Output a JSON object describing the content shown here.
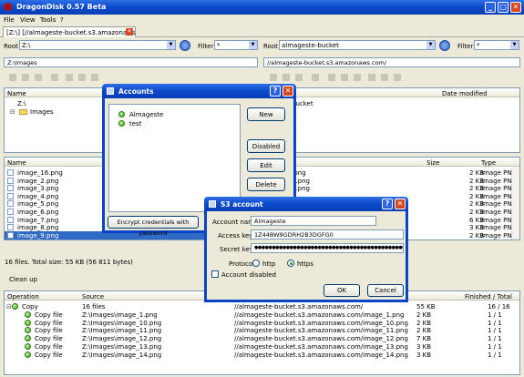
{
  "window": {
    "title": "DragonDisk 0.57 Beta"
  },
  "menu": [
    "File",
    "View",
    "Tools",
    "?"
  ],
  "tab": {
    "label": "[Z:\\] [//almageste-bucket.s3.amazonaws.com/]"
  },
  "left": {
    "root_label": "Root",
    "root_value": "Z:\\",
    "filter_label": "Filter",
    "filter_value": "*",
    "path": "Z:\\Images",
    "tree_header": "Name",
    "tree_items": [
      "Z:\\",
      "Images"
    ],
    "list_headers": [
      "Name"
    ],
    "files": [
      "image_16.png",
      "image_2.png",
      "image_3.png",
      "image_4.png",
      "image_5.png",
      "image_6.png",
      "image_7.png",
      "image_8.png",
      "image_9.png"
    ],
    "status": "16 files. Total size: 55 KB (56 811 bytes)"
  },
  "right": {
    "root_label": "Root",
    "root_value": "almageste-bucket",
    "filter_label": "Filter",
    "filter_value": "*",
    "path": "//almageste-bucket.s3.amazonaws.com/",
    "tree_headers": [
      "",
      "Date modified"
    ],
    "tree_value": "bucket",
    "list_headers": [
      "",
      "Size",
      "Type"
    ],
    "files": [
      {
        "name": ".png",
        "size": "2 KB",
        "type": "Image PNG"
      },
      {
        "name": "0.png",
        "size": "2 KB",
        "type": "Image PNG"
      },
      {
        "name": "1.png",
        "size": "2 KB",
        "type": "Image PNG"
      },
      {
        "name": "",
        "size": "2 KB",
        "type": "Image PNG"
      },
      {
        "name": "",
        "size": "2 KB",
        "type": "Image PNG"
      },
      {
        "name": "",
        "size": "2 KB",
        "type": "Image PNG"
      },
      {
        "name": "",
        "size": "6 KB",
        "type": "Image PNG"
      },
      {
        "name": "",
        "size": "3 KB",
        "type": "Image PNG"
      },
      {
        "name": "",
        "size": "2 KB",
        "type": "Image PNG"
      }
    ]
  },
  "cleanup": "Clean up",
  "queue": {
    "headers": [
      "Operation",
      "Source",
      "",
      "Finished / Total"
    ],
    "rows": [
      {
        "op": "Copy",
        "src": "16 files",
        "dst": "//almageste-bucket.s3.amazonaws.com/",
        "size": "55 KB",
        "fin": "16 / 16"
      },
      {
        "op": "Copy file",
        "src": "Z:\\Images\\image_1.png",
        "dst": "//almageste-bucket.s3.amazonaws.com/image_1.png",
        "size": "2 KB",
        "fin": "1 / 1"
      },
      {
        "op": "Copy file",
        "src": "Z:\\Images\\image_10.png",
        "dst": "//almageste-bucket.s3.amazonaws.com/image_10.png",
        "size": "2 KB",
        "fin": "1 / 1"
      },
      {
        "op": "Copy file",
        "src": "Z:\\Images\\image_11.png",
        "dst": "//almageste-bucket.s3.amazonaws.com/image_11.png",
        "size": "2 KB",
        "fin": "1 / 1"
      },
      {
        "op": "Copy file",
        "src": "Z:\\Images\\image_12.png",
        "dst": "//almageste-bucket.s3.amazonaws.com/image_12.png",
        "size": "7 KB",
        "fin": "1 / 1"
      },
      {
        "op": "Copy file",
        "src": "Z:\\Images\\image_13.png",
        "dst": "//almageste-bucket.s3.amazonaws.com/image_13.png",
        "size": "3 KB",
        "fin": "1 / 1"
      },
      {
        "op": "Copy file",
        "src": "Z:\\Images\\image_14.png",
        "dst": "//almageste-bucket.s3.amazonaws.com/image_14.png",
        "size": "3 KB",
        "fin": "1 / 1"
      }
    ]
  },
  "accounts": {
    "title": "Accounts",
    "items": [
      "Almageste",
      "test"
    ],
    "new": "New",
    "disabled": "Disabled",
    "edit": "Edit",
    "delete": "Delete",
    "encrypt": "Encrypt credentials with password"
  },
  "s3": {
    "title": "S3 account",
    "account_name_label": "Account name",
    "account_name": "Almageste",
    "access_key_label": "Access key",
    "access_key": "1Z44BW9GDRH2B3DGFG0",
    "secret_key_label": "Secret key",
    "secret_key": "●●●●●●●●●●●●●●●●●●●●●●●●●●●●●●●●●●●●●●●●●●●●●●●●●●●●●●●●",
    "protocol_label": "Protocol",
    "http": "http",
    "https": "https",
    "account_disabled": "Account disabled",
    "ok": "OK",
    "cancel": "Cancel"
  }
}
